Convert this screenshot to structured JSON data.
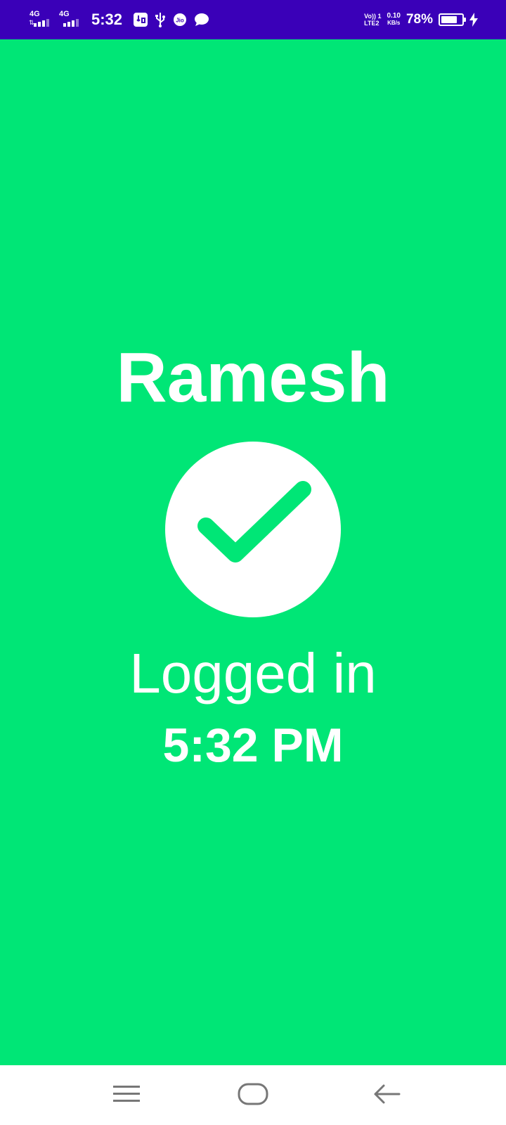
{
  "status_bar": {
    "sim1_network": "4G",
    "sim2_network": "4G",
    "time": "5:32",
    "notification_icons": [
      "usb-debug-icon",
      "usb-icon",
      "jio-icon",
      "message-icon"
    ],
    "jio_label": "Jio",
    "volte_line1": "Vo)) 1",
    "volte_line2": "LTE2",
    "data_speed": "0.10",
    "data_speed_unit": "KB/s",
    "battery_percent": "78%",
    "battery_level": 0.78,
    "charging": true,
    "background_color": "#3a00b8"
  },
  "main": {
    "user_name": "Ramesh",
    "status_icon": "checkmark-icon",
    "status_label": "Logged in",
    "login_time": "5:32 PM",
    "background_color": "#00e676"
  },
  "nav_bar": {
    "buttons": [
      "menu-icon",
      "home-icon",
      "back-icon"
    ]
  }
}
